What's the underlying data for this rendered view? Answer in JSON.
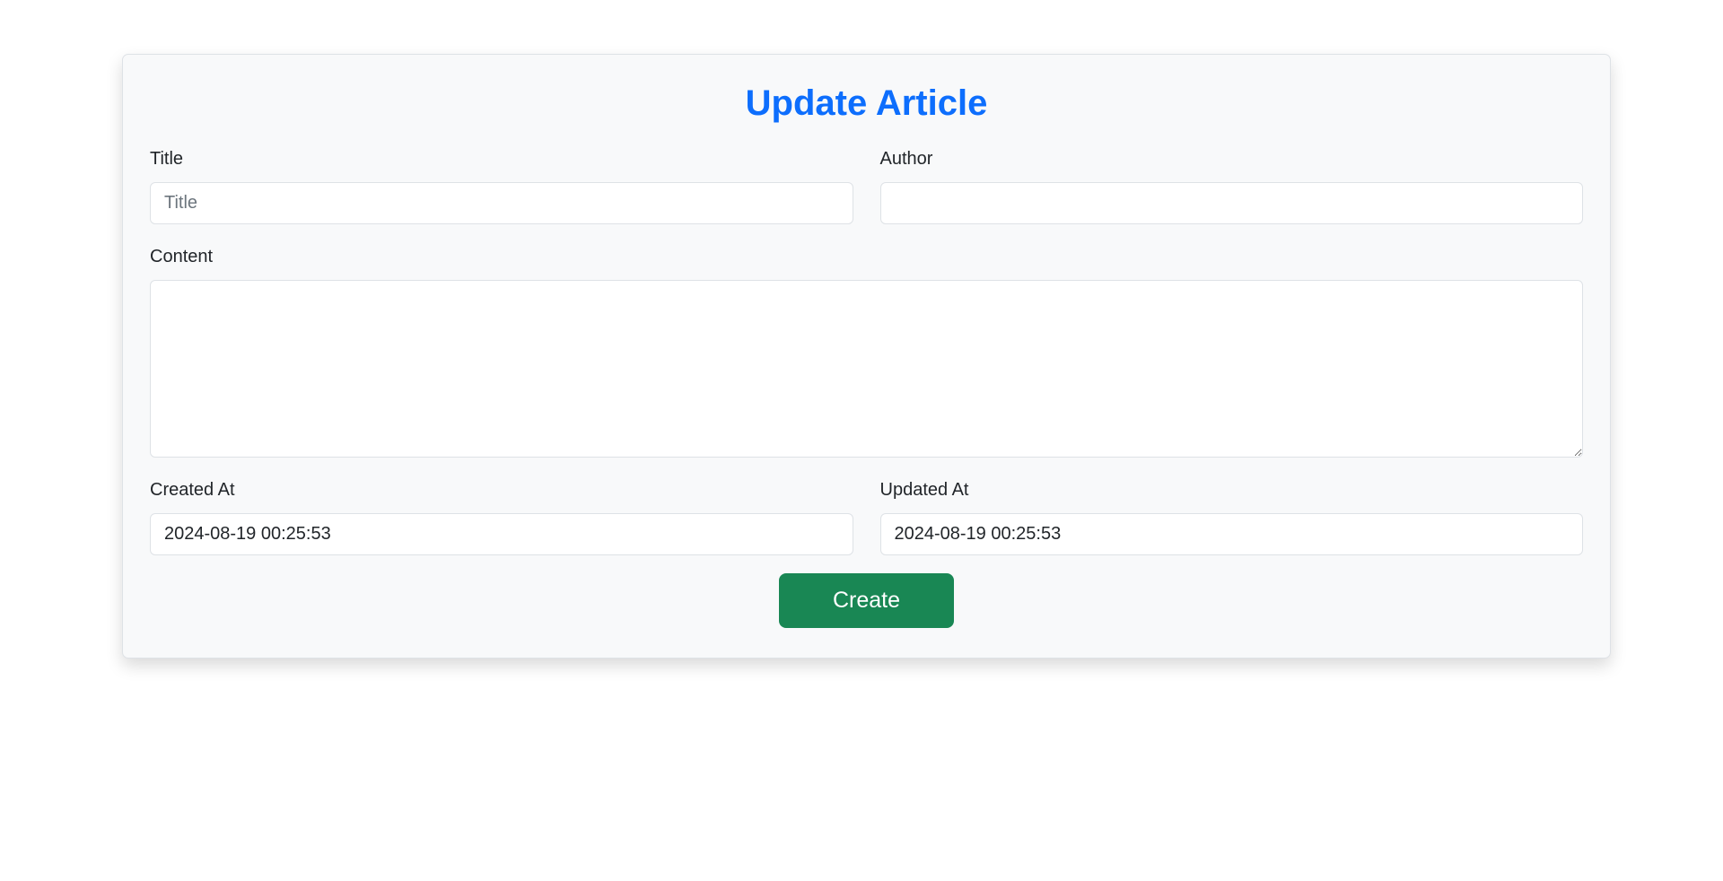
{
  "form": {
    "heading": "Update Article",
    "title": {
      "label": "Title",
      "placeholder": "Title",
      "value": ""
    },
    "author": {
      "label": "Author",
      "placeholder": "",
      "value": ""
    },
    "content": {
      "label": "Content",
      "placeholder": "",
      "value": ""
    },
    "created_at": {
      "label": "Created At",
      "value": "2024-08-19 00:25:53"
    },
    "updated_at": {
      "label": "Updated At",
      "value": "2024-08-19 00:25:53"
    },
    "submit_label": "Create"
  },
  "colors": {
    "heading": "#0d6efd",
    "button": "#198754",
    "card_background": "#f8f9fa"
  }
}
